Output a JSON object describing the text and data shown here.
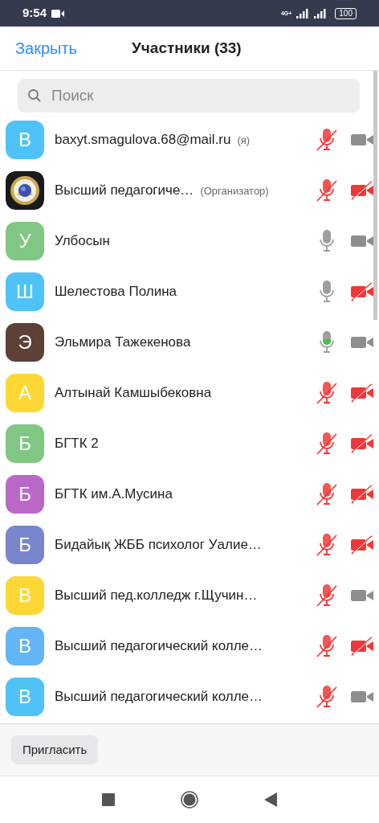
{
  "status_bar": {
    "time": "9:54",
    "network": "4G+",
    "battery": "100"
  },
  "header": {
    "close": "Закрыть",
    "title": "Участники (33)"
  },
  "search": {
    "placeholder": "Поиск"
  },
  "participants": [
    {
      "initial": "B",
      "color": "#4fc3f7",
      "name": "baxyt.smagulova.68@mail.ru",
      "tag": "(я)",
      "muted": true,
      "video_on": true
    },
    {
      "kind": "picture",
      "name": "Высший педагогиче…",
      "tag": "(Организатор)",
      "muted": true,
      "video_on": false
    },
    {
      "initial": "У",
      "color": "#81c784",
      "name": "Улбосын",
      "muted": false,
      "video_on": true
    },
    {
      "initial": "Ш",
      "color": "#4fc3f7",
      "name": "Шелестова Полина",
      "muted": false,
      "video_on": false
    },
    {
      "initial": "Э",
      "color": "#5d4037",
      "name": "Эльмира Тажекенова",
      "muted": false,
      "speaking": true,
      "video_on": true
    },
    {
      "initial": "А",
      "color": "#fdd835",
      "name": "Алтынай Камшыбековна",
      "muted": true,
      "video_on": false
    },
    {
      "initial": "Б",
      "color": "#81c784",
      "name": "БГТК 2",
      "muted": true,
      "video_on": false
    },
    {
      "initial": "Б",
      "color": "#ba68c8",
      "name": "БГТК им.А.Мусина",
      "muted": true,
      "video_on": false
    },
    {
      "initial": "Б",
      "color": "#7986cb",
      "name": "Бидайық ЖББ психолог Уалие…",
      "muted": true,
      "video_on": false
    },
    {
      "initial": "В",
      "color": "#fdd835",
      "name": "Высший пед.колледж г.Щучин…",
      "muted": true,
      "video_on": true
    },
    {
      "initial": "В",
      "color": "#64b5f6",
      "name": "Высший педагогический колле…",
      "muted": true,
      "video_on": false
    },
    {
      "initial": "В",
      "color": "#4fc3f7",
      "name": "Высший педагогический колле…",
      "muted": true,
      "video_on": true
    }
  ],
  "footer": {
    "invite": "Пригласить"
  }
}
